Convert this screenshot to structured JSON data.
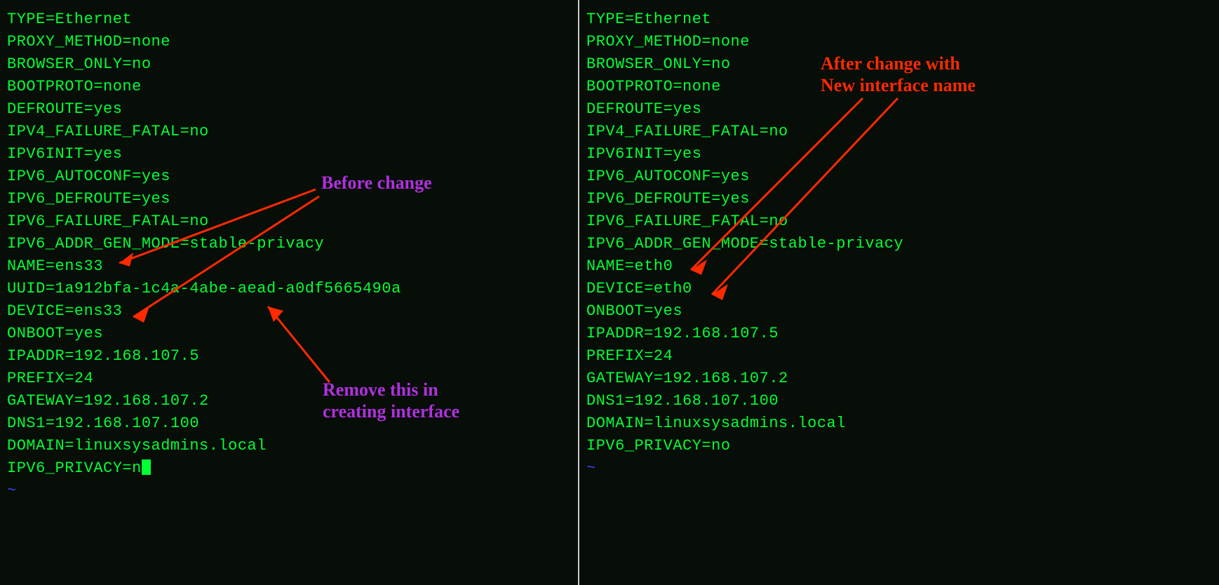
{
  "left": {
    "lines": [
      "TYPE=Ethernet",
      "PROXY_METHOD=none",
      "BROWSER_ONLY=no",
      "BOOTPROTO=none",
      "DEFROUTE=yes",
      "IPV4_FAILURE_FATAL=no",
      "IPV6INIT=yes",
      "IPV6_AUTOCONF=yes",
      "IPV6_DEFROUTE=yes",
      "IPV6_FAILURE_FATAL=no",
      "IPV6_ADDR_GEN_MODE=stable-privacy",
      "NAME=ens33",
      "UUID=1a912bfa-1c4a-4abe-aead-a0df5665490a",
      "DEVICE=ens33",
      "ONBOOT=yes",
      "IPADDR=192.168.107.5",
      "PREFIX=24",
      "GATEWAY=192.168.107.2",
      "DNS1=192.168.107.100",
      "DOMAIN=linuxsysadmins.local",
      "IPV6_PRIVACY=n"
    ],
    "tilde": "~"
  },
  "right": {
    "lines": [
      "TYPE=Ethernet",
      "PROXY_METHOD=none",
      "BROWSER_ONLY=no",
      "BOOTPROTO=none",
      "DEFROUTE=yes",
      "IPV4_FAILURE_FATAL=no",
      "IPV6INIT=yes",
      "IPV6_AUTOCONF=yes",
      "IPV6_DEFROUTE=yes",
      "IPV6_FAILURE_FATAL=no",
      "IPV6_ADDR_GEN_MODE=stable-privacy",
      "NAME=eth0",
      "DEVICE=eth0",
      "ONBOOT=yes",
      "IPADDR=192.168.107.5",
      "PREFIX=24",
      "GATEWAY=192.168.107.2",
      "DNS1=192.168.107.100",
      "DOMAIN=linuxsysadmins.local",
      "IPV6_PRIVACY=no"
    ],
    "tilde": "~"
  },
  "annotations": {
    "before_change": "Before change",
    "remove_this": "Remove this in\ncreating interface",
    "after_change": "After change with\nNew interface name"
  }
}
